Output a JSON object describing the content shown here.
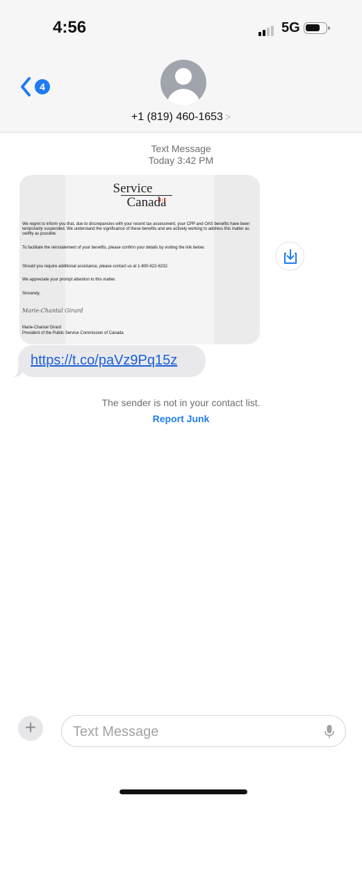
{
  "status_bar": {
    "time": "4:56",
    "network": "5G",
    "signal_bars": 2,
    "battery_icon": "battery-icon"
  },
  "header": {
    "back_icon": "chevron-left-icon",
    "unread_count": "4",
    "avatar_icon": "person-silhouette-icon",
    "contact": "+1 (819) 460-1653",
    "contact_chevron": ">"
  },
  "conversation": {
    "type_label": "Text Message",
    "timestamp": "Today 3:42 PM",
    "image_message": {
      "logo_line1": "Service",
      "logo_line2": "Canada",
      "paragraphs": [
        "We regret to inform you that, due to discrepancies with your recent tax assessment, your CPP and OAS benefits have been temporarily suspended. We understand the significance of these benefits and are actively working to address this matter as swiftly as possible.",
        "To facilitate the reinstatement of your benefits, please confirm your details by visiting the link below.",
        "Should you require additional assistance, please contact us at 1-800-622-6232.",
        "We appreciate your prompt attention to this matter.",
        "Sincerely,"
      ],
      "signature_script": "Marie-Chantal Girard",
      "signer_name": "Marie-Chantal Girard",
      "signer_title": "President of the Public Service Commission of Canada"
    },
    "save_icon": "save-to-photos-icon",
    "link": "https://t.co/paVz9Pq15z",
    "notice": "The sender is not in your contact list.",
    "report_junk": "Report Junk"
  },
  "composer": {
    "plus_label": "+",
    "placeholder": "Text Message",
    "mic_icon": "microphone-icon"
  },
  "colors": {
    "accent": "#1f7bf0",
    "link": "#1a5fd8",
    "header_bg": "#f6f6f6"
  }
}
